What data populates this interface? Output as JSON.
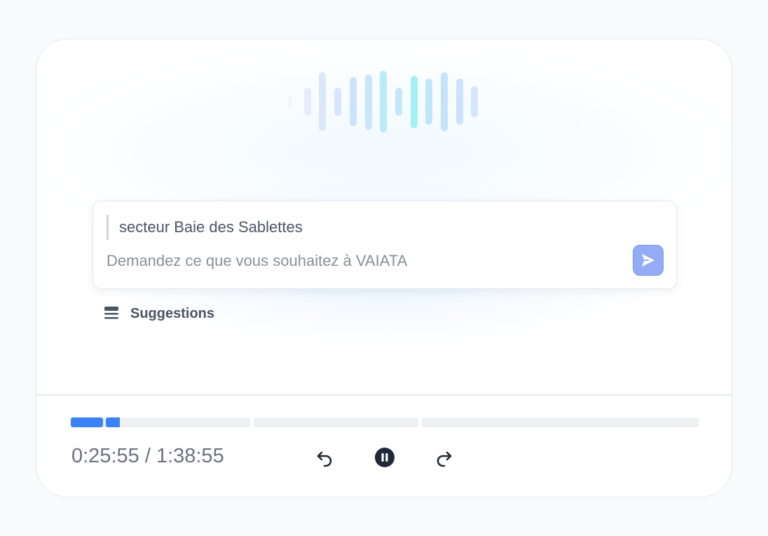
{
  "waveform": {
    "icon": "audio-waveform-icon",
    "levels": [
      0.2,
      0.45,
      0.95,
      0.45,
      0.8,
      0.9,
      1.0,
      0.45,
      0.85,
      0.75,
      0.95,
      0.75,
      0.5
    ],
    "colors": [
      "#f3f4f6",
      "#e6ecfb",
      "#dde7fb",
      "#d7e6fb",
      "#cbe3fb",
      "#c9e6fb",
      "#b9ecf9",
      "#c5e7fa",
      "#a5f0f7",
      "#c0e6fb",
      "#c5e3fb",
      "#cde2fb",
      "#d5e5fb"
    ]
  },
  "composer": {
    "quoted_context": "secteur Baie des Sablettes",
    "placeholder": "Demandez ce que vous souhaitez à VAIATA",
    "send_icon": "send-icon",
    "send_color": "#93acf5"
  },
  "suggestions": {
    "icon": "stack-icon",
    "label": "Suggestions"
  },
  "player": {
    "current_time": "0:25:55",
    "separator": " / ",
    "total_time": "1:38:55",
    "progress_fraction": 0.0796,
    "accent": "#3b82f6",
    "track_color": "#eef0f3",
    "controls": {
      "back_icon": "undo-arrow-icon",
      "pause_icon": "pause-icon",
      "forward_icon": "redo-arrow-icon"
    }
  }
}
